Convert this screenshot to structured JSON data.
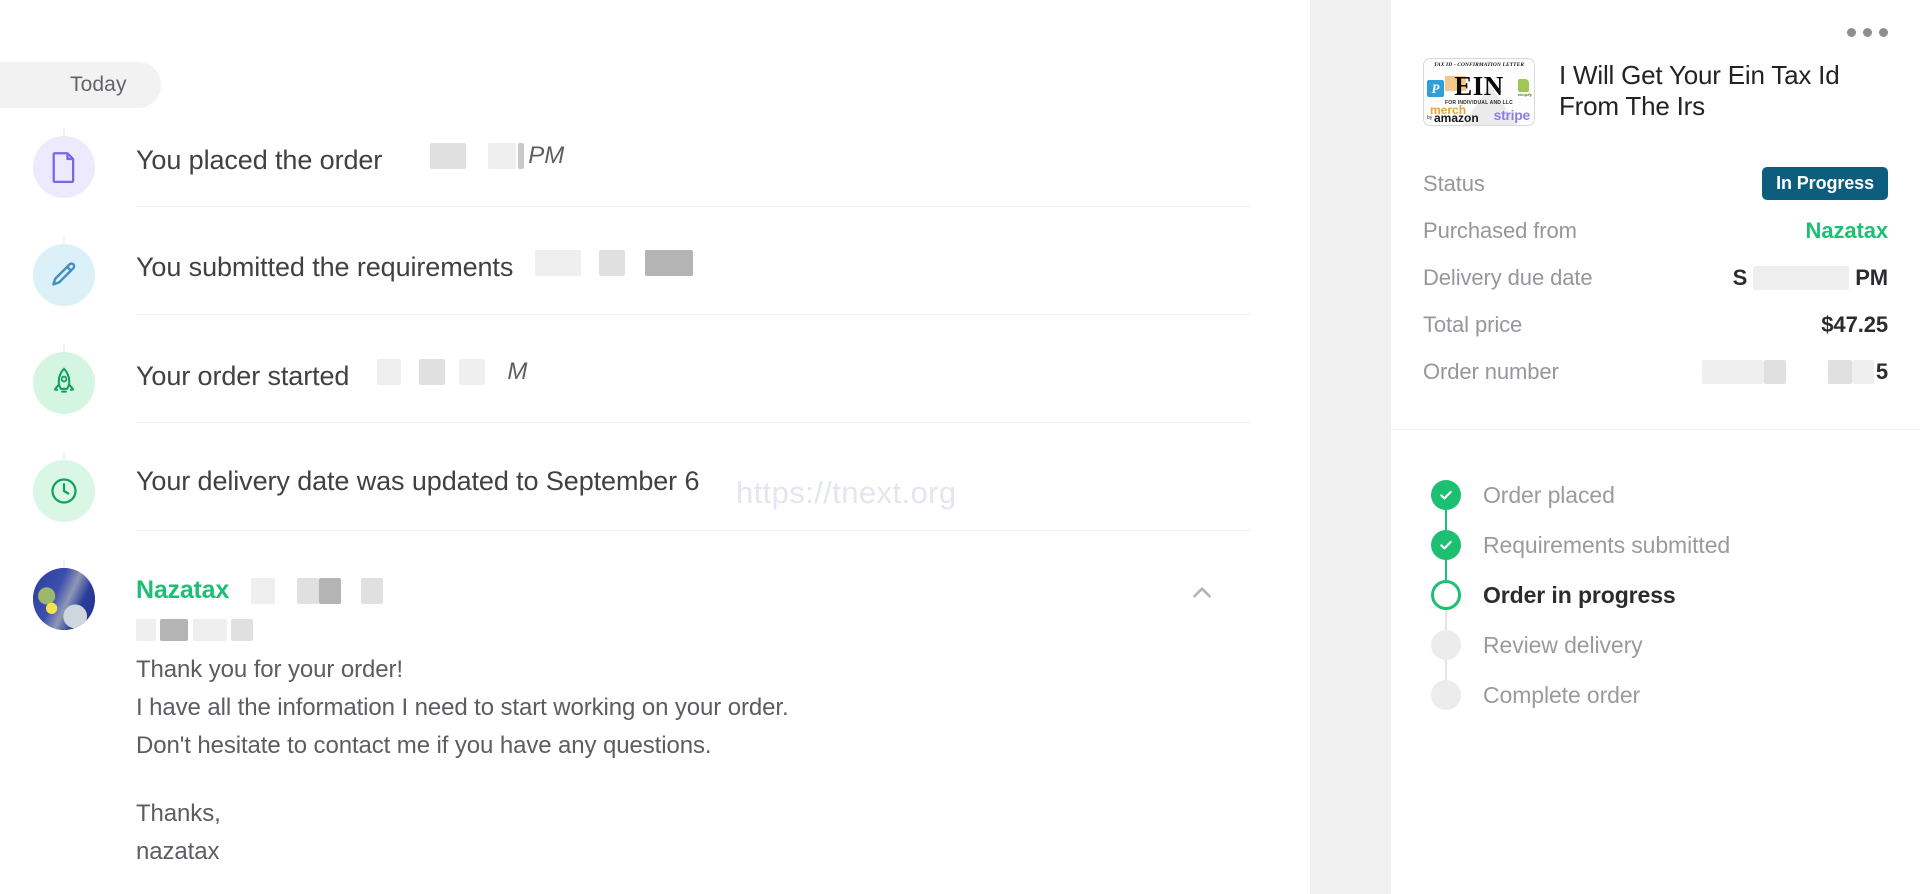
{
  "activity": {
    "date_divider": "Today",
    "events": [
      {
        "icon": "document-icon",
        "title": "You placed the order",
        "time_suffix": "PM",
        "redacted": true
      },
      {
        "icon": "pencil-icon",
        "title": "You submitted the requirements",
        "time_suffix": "",
        "redacted": true
      },
      {
        "icon": "rocket-icon",
        "title": "Your order started",
        "time_suffix": "M",
        "redacted": true
      },
      {
        "icon": "clock-icon",
        "title": "Your delivery date was updated to September 6",
        "time_suffix": "",
        "redacted": false
      }
    ],
    "watermark": "https://tnext.org",
    "message": {
      "author": "Nazatax",
      "collapse_icon": "chevron-up-icon",
      "lines": [
        "Thank you for your order!",
        "I have all the information I need to start working on your order.",
        "Don't hesitate to contact me if you have any questions.",
        "",
        "Thanks,",
        "nazatax"
      ]
    }
  },
  "order_panel": {
    "menu_icon": "more-options-icon",
    "gig_title": "I Will Get Your Ein Tax Id From The Irs",
    "thumbnail": {
      "header": "TAX ID - CONFIRMATION LETTER",
      "main": "EIN",
      "subtitle": "FOR INDIVIDUAL AND LLC",
      "brands": [
        "PayPal",
        "shopify",
        "merch",
        "by",
        "amazon",
        "stripe"
      ]
    },
    "details": [
      {
        "label": "Status",
        "value": "In Progress",
        "type": "badge"
      },
      {
        "label": "Purchased from",
        "value": "Nazatax",
        "type": "seller"
      },
      {
        "label": "Delivery due date",
        "value": "S",
        "value2": "PM",
        "type": "redacted"
      },
      {
        "label": "Total price",
        "value": "$47.25",
        "type": "text"
      },
      {
        "label": "Order number",
        "value": "5",
        "type": "redacted-number"
      }
    ],
    "steps": [
      {
        "label": "Order placed",
        "state": "done"
      },
      {
        "label": "Requirements submitted",
        "state": "done"
      },
      {
        "label": "Order in progress",
        "state": "current"
      },
      {
        "label": "Review delivery",
        "state": "todo"
      },
      {
        "label": "Complete order",
        "state": "todo"
      }
    ]
  },
  "colors": {
    "brand_green": "#1dbf73",
    "status_badge": "#0d5e7e",
    "text_primary": "#2b2c2f",
    "text_muted": "#95979d"
  }
}
